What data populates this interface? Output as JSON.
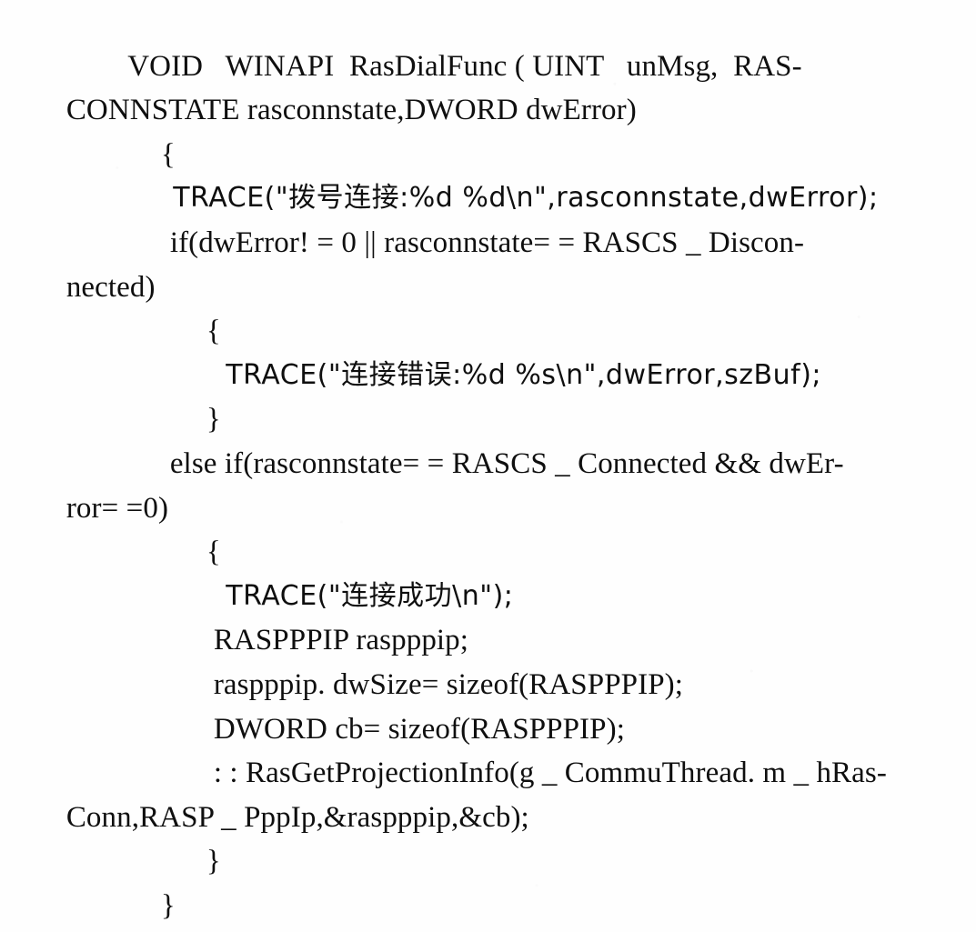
{
  "document": {
    "kind": "scanned-book-page",
    "language": "C++ source listing with Chinese string literals",
    "background_color": "#fefefe",
    "text_color": "#131313"
  },
  "code": {
    "lines": [
      {
        "id": "line-01",
        "indent": 1,
        "text": "VOID   WINAPI  RasDialFunc ( UINT   unMsg,  RAS-"
      },
      {
        "id": "line-02",
        "indent": 0,
        "text": "CONNSTATE rasconnstate,DWORD dwError)"
      },
      {
        "id": "line-03",
        "indent": 2,
        "text": "{"
      },
      {
        "id": "line-04",
        "indent": 2,
        "text": "TRACE(\"拨号连接:%d %d\\n\",rasconnstate,dwError);"
      },
      {
        "id": "line-05",
        "indent": 3,
        "text": "if(dwError! = 0 || rasconnstate= = RASCS _ Discon-"
      },
      {
        "id": "line-06",
        "indent": 0,
        "text": "nected)"
      },
      {
        "id": "line-07",
        "indent": 4,
        "text": "{"
      },
      {
        "id": "line-08",
        "indent": 5,
        "text": "TRACE(\"连接错误:%d %s\\n\",dwError,szBuf);"
      },
      {
        "id": "line-09",
        "indent": 4,
        "text": "}"
      },
      {
        "id": "line-10",
        "indent": 3,
        "text": "else if(rasconnstate= = RASCS _ Connected && dwEr-"
      },
      {
        "id": "line-11",
        "indent": 0,
        "text": "ror= =0)"
      },
      {
        "id": "line-12",
        "indent": 4,
        "text": "{"
      },
      {
        "id": "line-13",
        "indent": 5,
        "text": "TRACE(\"连接成功\\n\");"
      },
      {
        "id": "line-14",
        "indent": 5,
        "text": "RASPPPIP raspppip;"
      },
      {
        "id": "line-15",
        "indent": 5,
        "text": "raspppip. dwSize= sizeof(RASPPPIP);"
      },
      {
        "id": "line-16",
        "indent": 5,
        "text": "DWORD cb= sizeof(RASPPPIP);"
      },
      {
        "id": "line-17",
        "indent": 5,
        "text": ": : RasGetProjectionInfo(g _ CommuThread. m _ hRas-"
      },
      {
        "id": "line-18",
        "indent": 0,
        "text": "Conn,RASP _ PppIp,&raspppip,&cb);"
      },
      {
        "id": "line-19",
        "indent": 4,
        "text": "}"
      },
      {
        "id": "line-20",
        "indent": 2,
        "text": "}"
      }
    ],
    "function_signature": "VOID WINAPI RasDialFunc ( UINT unMsg, RASCONNSTATE rasconnstate, DWORD dwError)",
    "chinese_strings": [
      {
        "literal": "拨号连接",
        "meaning_label": "拨号连接"
      },
      {
        "literal": "连接错误",
        "meaning_label": "连接错误"
      },
      {
        "literal": "连接成功",
        "meaning_label": "连接成功"
      }
    ],
    "identifiers": [
      "VOID",
      "WINAPI",
      "RasDialFunc",
      "UINT",
      "unMsg",
      "RASCONNSTATE",
      "rasconnstate",
      "DWORD",
      "dwError",
      "TRACE",
      "RASCS _ Disconnected",
      "RASCS _ Connected",
      "szBuf",
      "RASPPPIP",
      "raspppip",
      "dwSize",
      "sizeof",
      "cb",
      "RasGetProjectionInfo",
      "g _ CommuThread. m _ hRasConn",
      "RASP _ PppIp"
    ]
  }
}
